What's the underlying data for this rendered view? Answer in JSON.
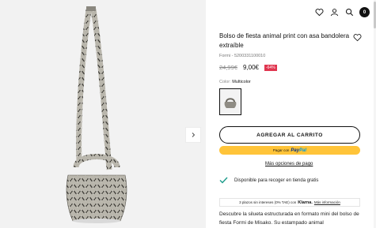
{
  "product": {
    "title": "Bolso de fiesta animal print con asa bandolera extraíble",
    "reference": "Formi - 5200331100010",
    "old_price": "24,99€",
    "new_price": "9,00€",
    "discount": "-64%",
    "color_label": "Color:",
    "color_value": "Multicolor"
  },
  "header": {
    "icons": [
      "heart-icon",
      "user-icon",
      "search-icon",
      "bag-icon"
    ],
    "cart_count": "0"
  },
  "actions": {
    "add_to_cart": "AGREGAR AL CARRITO",
    "paypal_pay": "Pagar con",
    "paypal_brand_a": "Pay",
    "paypal_brand_b": "Pal",
    "payment_options": "Más opciones de pago"
  },
  "pickup": {
    "text": "Disponible para recoger en tienda gratis"
  },
  "klarna": {
    "text": "3 plazos sin intereses (0% TAE) con",
    "brand": "Klarna.",
    "more": "Más información"
  },
  "description": "Descubre la silueta estructurada en formato mini del bolso de fiesta Formi de Misako. Su estampado animal",
  "colors": {
    "accent": "#111111",
    "discount": "#e0354f",
    "paypal": "#ffc439",
    "check": "#1a9b8a"
  }
}
